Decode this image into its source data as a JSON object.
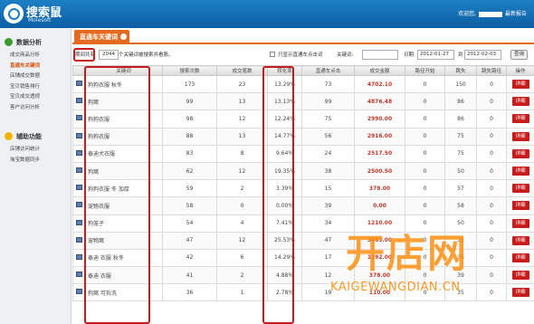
{
  "app": {
    "name": "搜索鼠",
    "sub": "Molesoft",
    "welcome": "欢迎您,",
    "last_login": "最新报告"
  },
  "sidebar": {
    "sections": [
      {
        "title": "数据分析",
        "items": [
          "成交商品分析",
          "直通车关键词",
          "店铺成交数据",
          "宝贝销售排行",
          "宝贝成交透视",
          "客户访问分析"
        ],
        "active_index": 1
      },
      {
        "title": "辅助功能",
        "items": [
          "店铺访问统计",
          "淘宝数据同步"
        ]
      }
    ]
  },
  "tab": {
    "label": "直通车关键词"
  },
  "filter": {
    "prefix": "期间共有",
    "count": "2044",
    "suffix": "个关键词被搜索并看股。",
    "checkbox_label": "只显示直通车点击词",
    "keyword_label": "关键词:",
    "keyword_value": "",
    "date_label": "日期:",
    "date_from": "2012-01-27",
    "to_label": "到",
    "date_to": "2012-02-03",
    "query": "查询"
  },
  "table": {
    "headers": [
      "",
      "关键词",
      "搜索次数",
      "成交笔数",
      "转化率",
      "直通车点击",
      "成交金额",
      "路径开始",
      "跳失",
      "跳失路径",
      "操作"
    ],
    "detail_label": "详细",
    "rows": [
      {
        "kw": "狗狗衣服 秋冬",
        "search": "173",
        "deals": "23",
        "rate": "13.29%",
        "ztc": "73",
        "amount": "4702.10",
        "start": "0",
        "bounce": "150",
        "bpath": "0"
      },
      {
        "kw": "狗窝",
        "search": "99",
        "deals": "13",
        "rate": "13.13%",
        "ztc": "99",
        "amount": "4876.48",
        "start": "0",
        "bounce": "86",
        "bpath": "0"
      },
      {
        "kw": "狗狗衣服",
        "search": "98",
        "deals": "12",
        "rate": "12.24%",
        "ztc": "75",
        "amount": "2990.00",
        "start": "0",
        "bounce": "86",
        "bpath": "0"
      },
      {
        "kw": "狗狗衣服",
        "search": "88",
        "deals": "13",
        "rate": "14.77%",
        "ztc": "56",
        "amount": "2916.00",
        "start": "0",
        "bounce": "75",
        "bpath": "0"
      },
      {
        "kw": "泰迪犬衣服",
        "search": "83",
        "deals": "8",
        "rate": "9.64%",
        "ztc": "24",
        "amount": "2517.50",
        "start": "0",
        "bounce": "75",
        "bpath": "0"
      },
      {
        "kw": "狗窝",
        "search": "62",
        "deals": "12",
        "rate": "19.35%",
        "ztc": "38",
        "amount": "2500.50",
        "start": "0",
        "bounce": "50",
        "bpath": "0"
      },
      {
        "kw": "狗狗衣服 冬 加厚",
        "search": "59",
        "deals": "2",
        "rate": "3.39%",
        "ztc": "15",
        "amount": "378.00",
        "start": "0",
        "bounce": "57",
        "bpath": "0"
      },
      {
        "kw": "宠物衣服",
        "search": "58",
        "deals": "0",
        "rate": "0.00%",
        "ztc": "39",
        "amount": "0.00",
        "start": "0",
        "bounce": "58",
        "bpath": "0"
      },
      {
        "kw": "狗笼子",
        "search": "54",
        "deals": "4",
        "rate": "7.41%",
        "ztc": "34",
        "amount": "1210.00",
        "start": "0",
        "bounce": "50",
        "bpath": "0"
      },
      {
        "kw": "宠物窝",
        "search": "47",
        "deals": "12",
        "rate": "25.53%",
        "ztc": "47",
        "amount": "3469.00",
        "start": "0",
        "bounce": "35",
        "bpath": "0"
      },
      {
        "kw": "泰迪 衣服 秋冬",
        "search": "42",
        "deals": "6",
        "rate": "14.29%",
        "ztc": "17",
        "amount": "1192.00",
        "start": "0",
        "bounce": "36",
        "bpath": "0"
      },
      {
        "kw": "泰迪 衣服",
        "search": "41",
        "deals": "2",
        "rate": "4.88%",
        "ztc": "12",
        "amount": "378.00",
        "start": "0",
        "bounce": "39",
        "bpath": "0"
      },
      {
        "kw": "狗窝 可拆洗",
        "search": "36",
        "deals": "1",
        "rate": "2.78%",
        "ztc": "19",
        "amount": "110.00",
        "start": "0",
        "bounce": "35",
        "bpath": "0"
      }
    ]
  },
  "watermark": {
    "chinese": "开店网",
    "latin": "KAIGEWANGDIAN.CN"
  }
}
